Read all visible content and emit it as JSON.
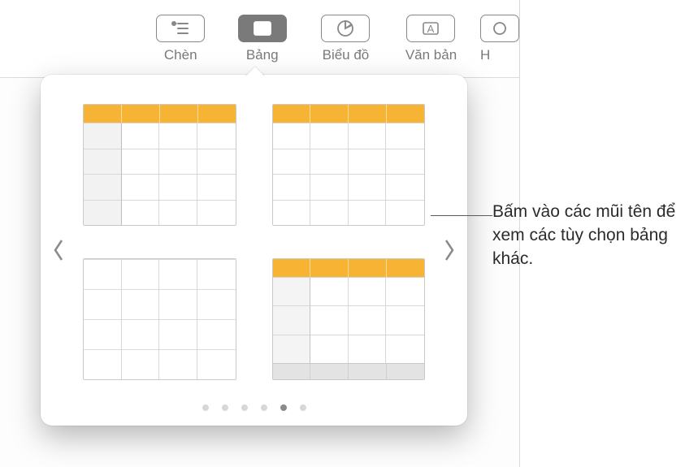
{
  "toolbar": {
    "insert_label": "Chèn",
    "table_label": "Bảng",
    "chart_label": "Biểu đồ",
    "text_label": "Văn bản",
    "shape_label": "H"
  },
  "popover": {
    "accent_color": "#f6b334",
    "table_styles": [
      {
        "id": "style-header-rowlabel",
        "has_header": true,
        "has_row_header": true,
        "has_footer": false
      },
      {
        "id": "style-header-only",
        "has_header": true,
        "has_row_header": false,
        "has_footer": false
      },
      {
        "id": "style-plain",
        "has_header": false,
        "has_row_header": false,
        "has_footer": false
      },
      {
        "id": "style-header-footer",
        "has_header": true,
        "has_row_header": true,
        "has_footer": true
      }
    ],
    "page_count": 6,
    "active_page_index": 4
  },
  "callout": {
    "text": "Bấm vào các mũi tên để xem các tùy chọn bảng khác."
  }
}
